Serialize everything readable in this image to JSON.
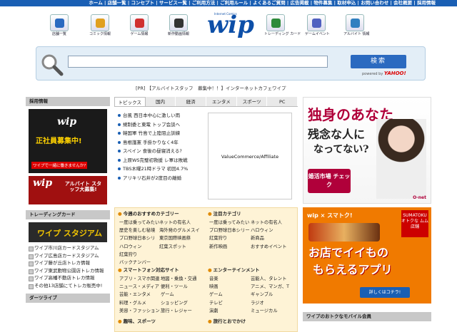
{
  "topnav": "ホーム | 店舗一覧 | コンセプト | サービス一覧 | ご利用方法 | ご利用ルール | よくあるご質問 | 広告掲載 | 物件募集 | 取材申込 | お問い合わせ | 会社概要 | 採用情報",
  "icons": [
    {
      "label": "店舗一覧",
      "icon": "store-list-icon",
      "color": "#2b6ac0"
    },
    {
      "label": "コミック情報",
      "icon": "comic-icon",
      "color": "#e0a020"
    },
    {
      "label": "ゲーム情報",
      "icon": "game-icon",
      "color": "#d03030"
    },
    {
      "label": "新作動画情報",
      "icon": "movie-icon",
      "color": "#333333"
    },
    {
      "label": "トレーディング カード",
      "icon": "trading-card-icon",
      "color": "#2e8b3a"
    },
    {
      "label": "ゲームイベント",
      "icon": "game-event-icon",
      "color": "#5060c0"
    },
    {
      "label": "アルバイト 情報",
      "icon": "job-info-icon",
      "color": "#3080c0"
    }
  ],
  "logo": {
    "text": "wip",
    "tag": "Internet Comics"
  },
  "search": {
    "button": "検索",
    "powered": "powered by",
    "brand": "YAHOO!"
  },
  "pr": "[PR] 【アルバイトスタッフ　募集中！！】インターネットカフェワイプ",
  "left": {
    "recruit_header": "採用情報",
    "banner1": {
      "brand": "wip",
      "text": "正社員募集中!",
      "sub": "ワイプで一緒に働きませんか?"
    },
    "banner2": {
      "brand": "wip",
      "text": "アルバイト スタッフ大募集!"
    },
    "trade_header": "トレーディングカード",
    "trade_banner": "ワイプ スタジアム",
    "trade_items": [
      "ワイプ市川店カードスタジアム",
      "ワイプ広島店カードスタジアム",
      "ワイプ藤が丘店トレカ情報",
      "ワイプ東武動物公園店トレカ情報",
      "ワイプ高幡不動店トレカ情報",
      "その他13店舗にてトレカ販売中!"
    ],
    "darts_header": "ダーツライブ"
  },
  "tabs": [
    "トピックス",
    "国内",
    "経済",
    "エンタメ",
    "スポーツ",
    "PC"
  ],
  "news": [
    "台風 西日本中心に激しい雨",
    "規制委と東電 トップ会談へ",
    "韓国軍 竹島で上陸阻止訓練",
    "島根護憲 手掛かりなく4年",
    "スペイン 食後の昼寝消える?",
    "上原WS完璧初救援 レ軍は敗戦",
    "TBS木曜21時ドラマ 初回4.7%",
    "アリキリ石井が2度目の離婚"
  ],
  "vc_ad": "ValueCommerce/Affiliate",
  "cats": {
    "h1": "今週のおすすめカテゴリー",
    "c1": [
      "一度は乗ってみたい",
      "歴史を楽しむ秘境",
      "プロ野球日本シリ",
      "ハロウィン",
      "紅葉狩り",
      "バックナンバー"
    ],
    "c1b": [
      "ネットの有名人",
      "海外発のグルメスイ",
      "東京国際映画祭",
      "紅葉スポット"
    ],
    "h2": "注目カテゴリ",
    "c2": [
      "一度は乗ってみたい",
      "プロ野球日本シリー",
      "紅葉狩り",
      "新作映画"
    ],
    "c2b": [
      "ネットの有名人",
      "ハロウィン",
      "新商品",
      "おすすめイベント"
    ],
    "h3": "スマートフォン対応サイト",
    "c3": [
      "アプリ・スマホ関連",
      "ニュース・メディア",
      "芸能・エンタメ",
      "料理・グルメ",
      "美容・ファッション"
    ],
    "c3b": [
      "地図・乗換・交通",
      "便利・ツール",
      "ゲーム",
      "ショッピング",
      "旅行・レジャー"
    ],
    "h4": "エンターテインメント",
    "c4": [
      "音楽",
      "映画",
      "ゲーム",
      "テレビ",
      "演劇"
    ],
    "c4b": [
      "芸能人、タレント",
      "アニメ、マンガ、T",
      "ギャンブル",
      "ラジオ",
      "ミュージカル"
    ],
    "h5": "趣味、スポーツ",
    "h6": "旅行とおでかけ"
  },
  "ad1": {
    "l1": "独身のあなた",
    "l2": "残念な人に",
    "l3": "なってない?",
    "btn": "婚活市場 チェック",
    "brand": "O-net"
  },
  "ad2": {
    "top": "wip × スマトク!",
    "l1": "お店でイイもの",
    "l2": "もらえるアプリ",
    "btn": "詳しくはコチラ!",
    "stamp": "SUMATOKU オトクな ムム店舗"
  },
  "mobile_header": "ワイプのおトクなモバイル会員"
}
